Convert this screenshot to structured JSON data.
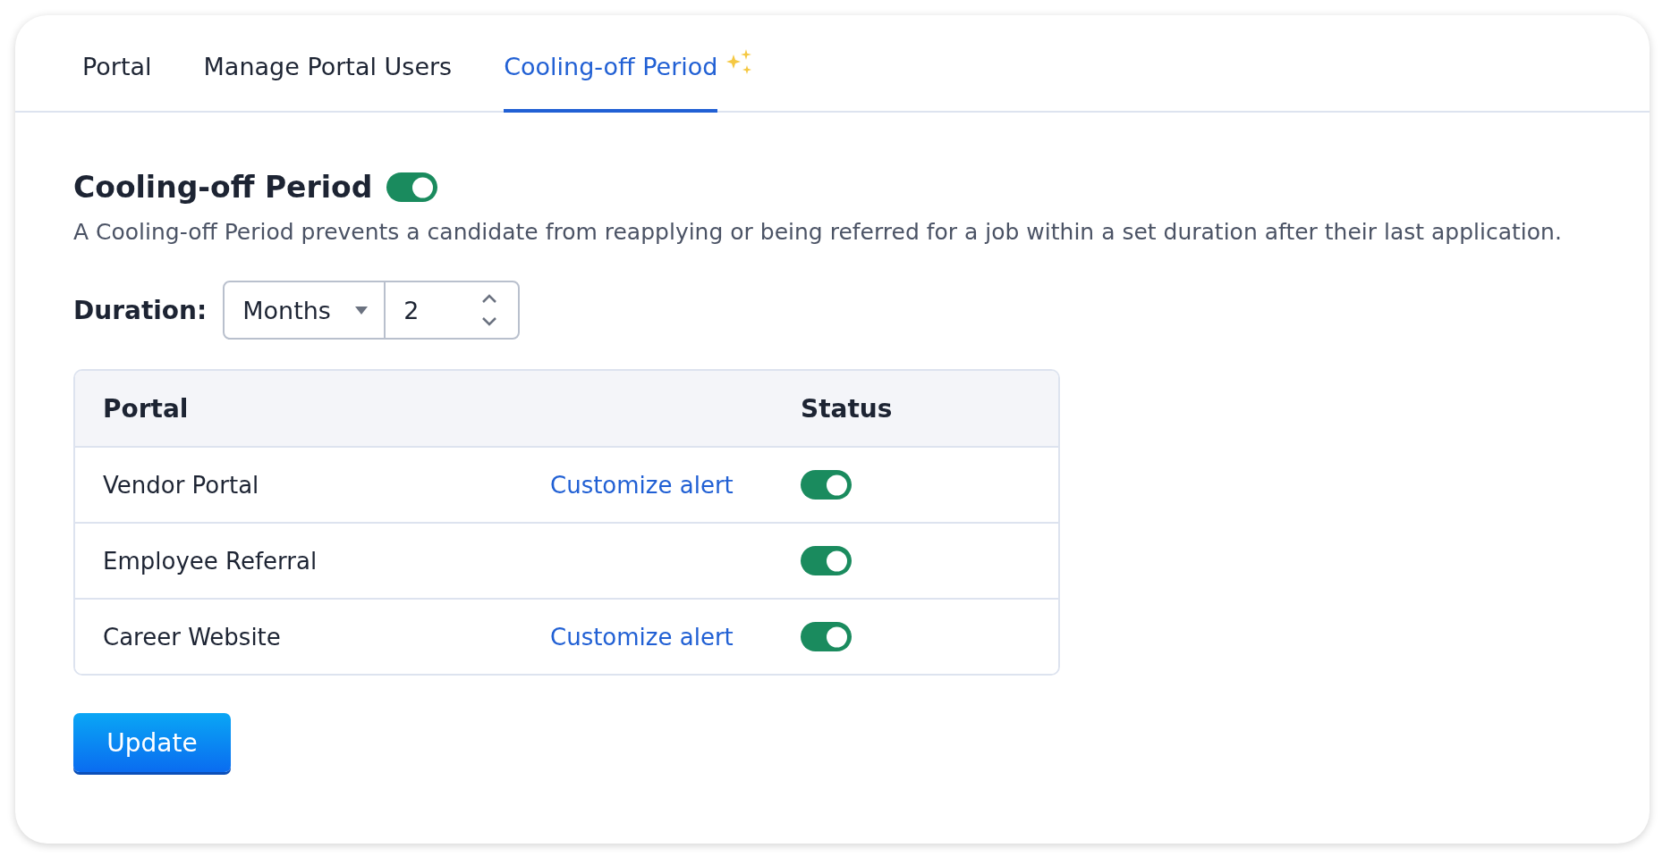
{
  "tabs": [
    {
      "label": "Portal",
      "selected": false,
      "sparkle": false
    },
    {
      "label": "Manage Portal Users",
      "selected": false,
      "sparkle": false
    },
    {
      "label": "Cooling-off Period",
      "selected": true,
      "sparkle": true
    }
  ],
  "section": {
    "title": "Cooling-off Period",
    "on": true,
    "description": "A Cooling-off Period prevents a candidate from reapplying or being referred for a job within a set duration after their last application."
  },
  "duration": {
    "label": "Duration:",
    "unit": "Months",
    "value": "2"
  },
  "table": {
    "columns": [
      "Portal",
      "Status"
    ],
    "rows": [
      {
        "portal": "Vendor Portal",
        "link": "Customize alert",
        "on": true
      },
      {
        "portal": "Employee Referral",
        "on": true
      },
      {
        "portal": "Career Website",
        "link": "Customize alert",
        "on": true
      }
    ]
  },
  "button": "Update"
}
